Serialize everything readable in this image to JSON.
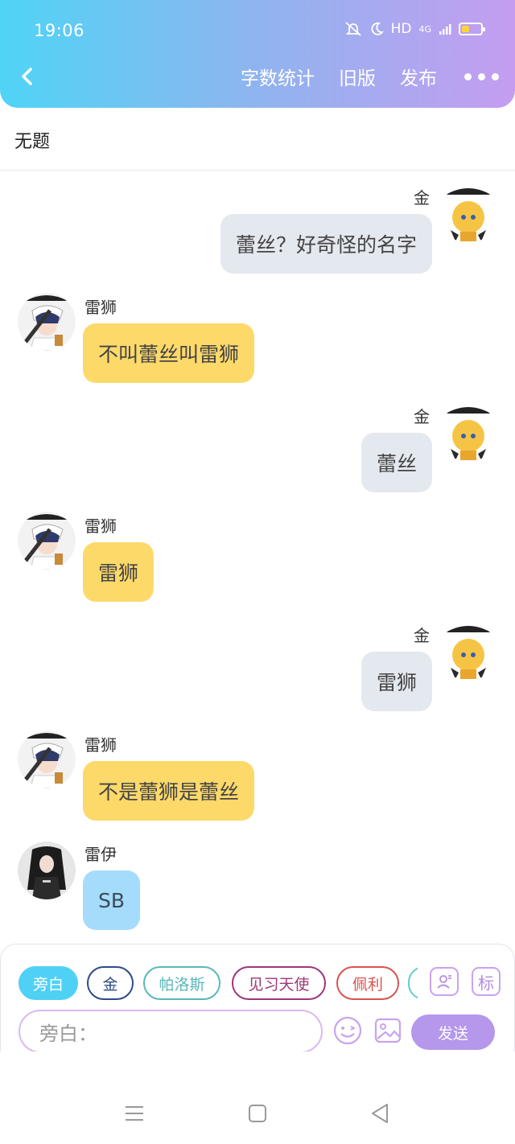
{
  "status_bar": {
    "time": "19:06",
    "network": "HD",
    "signal": "4G",
    "battery_level": 0.3
  },
  "toolbar": {
    "back_icon": "chevron-left-icon",
    "word_count": "字数统计",
    "old_version": "旧版",
    "publish": "发布",
    "more_icon": "more-dots-icon"
  },
  "document": {
    "title": "无题"
  },
  "messages": [
    {
      "speaker": "金",
      "text": "蕾丝？好奇怪的名字",
      "side": "right",
      "bubble_color": "#e4e8ef"
    },
    {
      "speaker": "雷狮",
      "text": "不叫蕾丝叫雷狮",
      "side": "left",
      "bubble_color": "#fdd96a"
    },
    {
      "speaker": "金",
      "text": "蕾丝",
      "side": "right",
      "bubble_color": "#e4e8ef"
    },
    {
      "speaker": "雷狮",
      "text": "雷狮",
      "side": "left",
      "bubble_color": "#fdd96a"
    },
    {
      "speaker": "金",
      "text": "雷狮",
      "side": "right",
      "bubble_color": "#e4e8ef"
    },
    {
      "speaker": "雷狮",
      "text": "不是蕾狮是蕾丝",
      "side": "left",
      "bubble_color": "#fdd96a"
    },
    {
      "speaker": "雷伊",
      "text": "SB",
      "side": "left",
      "bubble_color": "#a6dcfb"
    }
  ],
  "composer": {
    "roles": [
      {
        "label": "旁白",
        "color": "#4fd1f5",
        "selected": true
      },
      {
        "label": "金",
        "color": "#2e4a8a",
        "selected": false
      },
      {
        "label": "帕洛斯",
        "color": "#5ab8b8",
        "selected": false
      },
      {
        "label": "见习天使",
        "color": "#a0357a",
        "selected": false
      },
      {
        "label": "佩利",
        "color": "#d9534f",
        "selected": false
      }
    ],
    "add_role_icon": "person-add-icon",
    "tag_label": "标",
    "input_placeholder": "旁白：",
    "emoji_icon": "emoji-icon",
    "image_icon": "image-icon",
    "send_label": "发送"
  },
  "system_nav": {
    "menu_icon": "menu-icon",
    "home_icon": "home-icon",
    "back_icon": "back-triangle-icon"
  }
}
